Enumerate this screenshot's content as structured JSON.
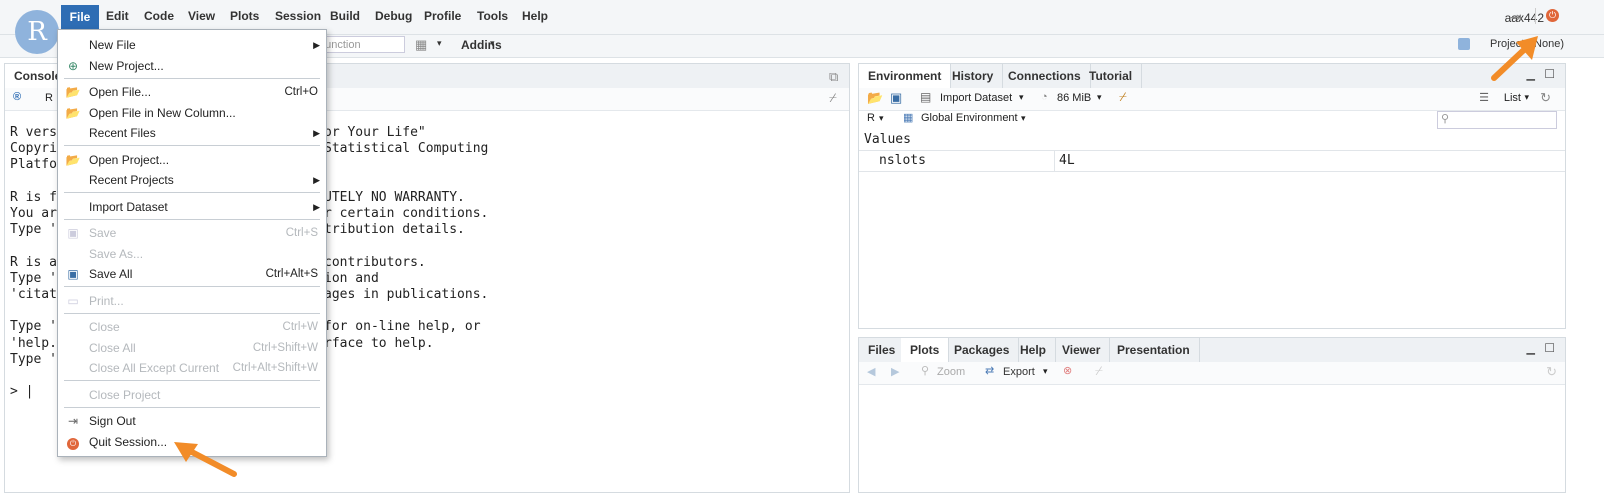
{
  "menubar": {
    "items": [
      "File",
      "Edit",
      "Code",
      "View",
      "Plots",
      "Session",
      "Build",
      "Debug",
      "Profile",
      "Tools",
      "Help"
    ],
    "user": "aax442"
  },
  "toolbar": {
    "goto_placeholder": "/function",
    "addins": "Addins",
    "project": "Project: (None)"
  },
  "console": {
    "tab": "Console",
    "r_label": "R",
    "lines": [
      "R version ... \"Sing for Your Life\"",
      "Copyright (C) ... Statistical Computing",
      "Platform ...",
      "",
      "R is free software ... ABSOLUTELY NO WARRANTY.",
      "You are welcome to redistribute it under certain conditions.",
      "Type 'license()' or 'licence()' for distribution details.",
      "",
      "R is a collaborative project with many contributors.",
      "Type 'contributors()' for more information and",
      "'citation()' on how to cite R or R packages in publications.",
      "",
      "Type 'demo()' for some demos, 'help()' for on-line help, or",
      "'help.start()' for an HTML browser interface to help.",
      "Type 'q()' to quit R.",
      "",
      "> |"
    ],
    "visible": [
      {
        "t": "R vers",
        "tail": "or Your Life\""
      },
      {
        "t": "Copyri",
        "tail": "Statistical Computing"
      },
      {
        "t": "Platfo",
        "tail": ""
      },
      {
        "t": "",
        "tail": ""
      },
      {
        "t": "R is f",
        "tail": "UTELY NO WARRANTY."
      },
      {
        "t": "You ar",
        "tail": "r certain conditions."
      },
      {
        "t": "Type '",
        "tail": "tribution details."
      },
      {
        "t": "",
        "tail": ""
      },
      {
        "t": "R is a",
        "tail": "contributors."
      },
      {
        "t": "Type '",
        "tail": "ion and"
      },
      {
        "t": "'citat",
        "tail": "ages in publications."
      },
      {
        "t": "",
        "tail": ""
      },
      {
        "t": "Type '",
        "tail": "for on-line help, or"
      },
      {
        "t": "'help.",
        "tail": "rface to help."
      },
      {
        "t": "Type '",
        "tail": ""
      },
      {
        "t": "",
        "tail": ""
      },
      {
        "t": "> |",
        "tail": ""
      }
    ]
  },
  "env_pane": {
    "tabs": [
      "Environment",
      "History",
      "Connections",
      "Tutorial"
    ],
    "import_dataset": "Import Dataset",
    "memory": "86 MiB",
    "list": "List",
    "lang": "R",
    "global_env": "Global Environment",
    "section": "Values",
    "rows": [
      {
        "name": "nslots",
        "value": "4L"
      }
    ]
  },
  "files_pane": {
    "tabs": [
      "Files",
      "Plots",
      "Packages",
      "Help",
      "Viewer",
      "Presentation"
    ],
    "zoom": "Zoom",
    "export": "Export"
  },
  "file_menu": {
    "items": [
      {
        "label": "New File",
        "submenu": true
      },
      {
        "label": "New Project..."
      },
      {
        "label": "Open File...",
        "shortcut": "Ctrl+O"
      },
      {
        "label": "Open File in New Column..."
      },
      {
        "label": "Recent Files",
        "submenu": true
      },
      {
        "label": "Open Project..."
      },
      {
        "label": "Recent Projects",
        "submenu": true
      },
      {
        "label": "Import Dataset",
        "submenu": true
      },
      {
        "label": "Save",
        "shortcut": "Ctrl+S",
        "disabled": true
      },
      {
        "label": "Save As...",
        "disabled": true
      },
      {
        "label": "Save All",
        "shortcut": "Ctrl+Alt+S"
      },
      {
        "label": "Print...",
        "disabled": true
      },
      {
        "label": "Close",
        "shortcut": "Ctrl+W",
        "disabled": true
      },
      {
        "label": "Close All",
        "shortcut": "Ctrl+Shift+W",
        "disabled": true
      },
      {
        "label": "Close All Except Current",
        "shortcut": "Ctrl+Alt+Shift+W",
        "disabled": true
      },
      {
        "label": "Close Project",
        "disabled": true
      },
      {
        "label": "Sign Out"
      },
      {
        "label": "Quit Session..."
      }
    ]
  },
  "colors": {
    "accent": "#2e6db4",
    "annotation_arrow": "#f28c28",
    "quit_icon": "#e0663a"
  }
}
